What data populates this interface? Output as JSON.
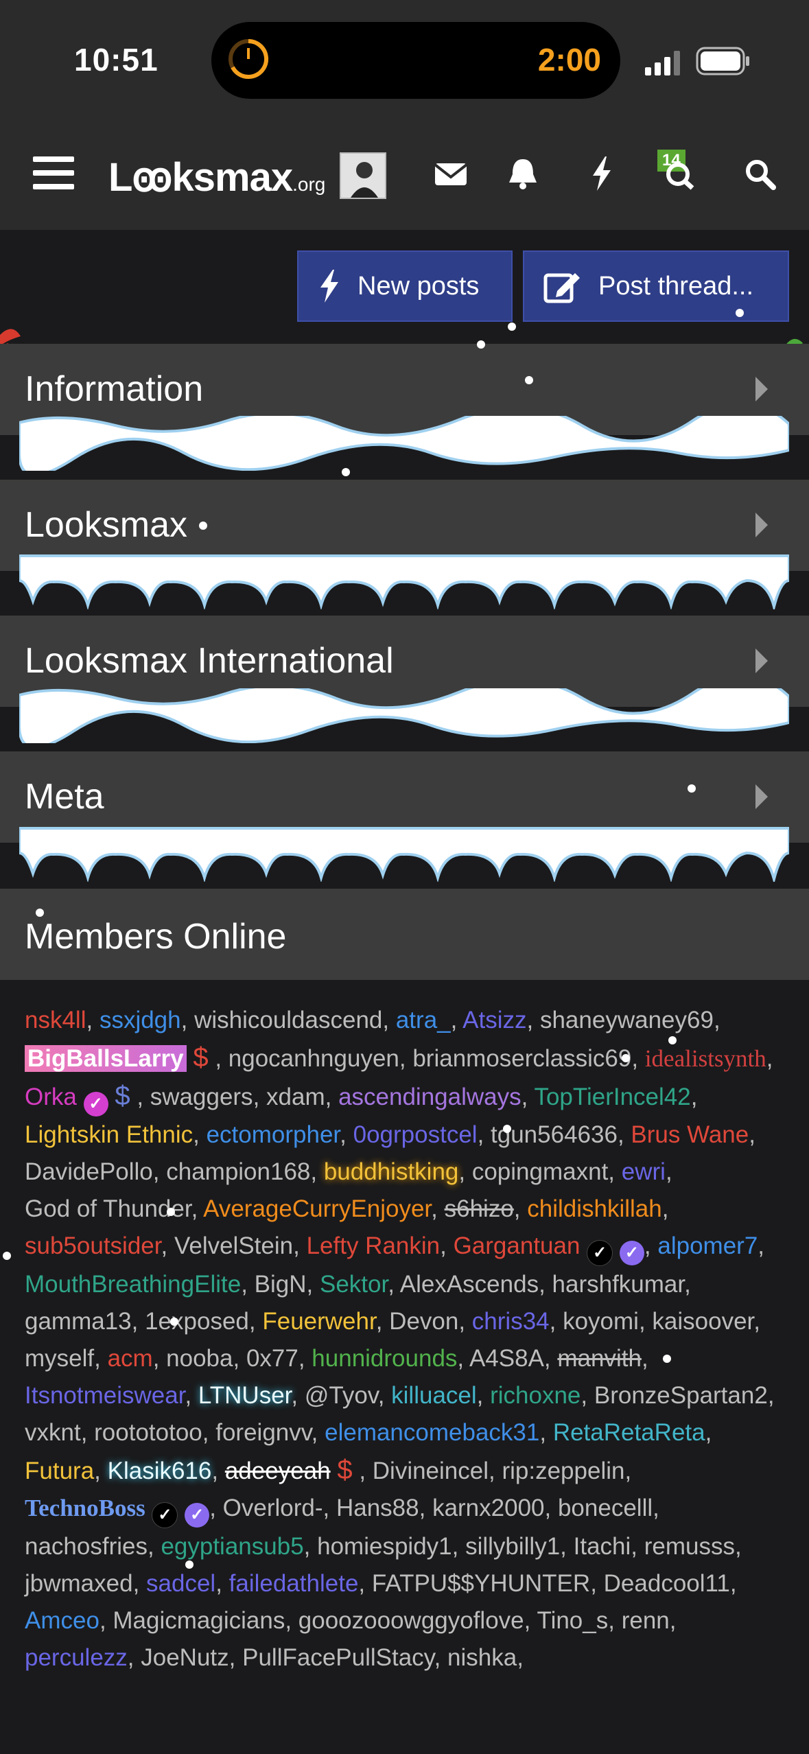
{
  "status": {
    "time": "10:51",
    "timer": "2:00"
  },
  "header": {
    "logo_main": "Lꙭksmax",
    "logo_suffix": ".org",
    "notif_count": "14"
  },
  "buttons": {
    "new_posts": "New posts",
    "post_thread": "Post thread..."
  },
  "categories": [
    "Information",
    "Looksmax",
    "Looksmax International",
    "Meta"
  ],
  "members_title": "Members Online",
  "members": [
    {
      "n": "nsk4ll",
      "c": "c-red"
    },
    {
      "n": "ssxjdgh",
      "c": "c-blue"
    },
    {
      "n": "wishicouldascend",
      "c": "c-gray"
    },
    {
      "n": "atra_",
      "c": "c-blue"
    },
    {
      "n": "Atsizz",
      "c": "c-indigo"
    },
    {
      "n": "shaneywaney69",
      "c": "c-gray"
    },
    {
      "n": "BigBallsLarry",
      "c": "glow-pink",
      "dollar": "red"
    },
    {
      "n": "ngocanhnguyen",
      "c": "c-gray"
    },
    {
      "n": "brianmoserclassic69",
      "c": "c-gray"
    },
    {
      "n": "idealistsynth",
      "c": "serif-red"
    },
    {
      "n": "Orka",
      "c": "c-magenta",
      "check": "mag",
      "dollar": "blue"
    },
    {
      "n": "swaggers",
      "c": "c-gray"
    },
    {
      "n": "xdam",
      "c": "c-gray"
    },
    {
      "n": "ascendingalways",
      "c": "c-purple"
    },
    {
      "n": "TopTierIncel42",
      "c": "c-teal"
    },
    {
      "n": "Lightskin Ethnic",
      "c": "c-yellow"
    },
    {
      "n": "ectomorpher",
      "c": "c-blue"
    },
    {
      "n": "0ogrpostcel",
      "c": "c-indigo"
    },
    {
      "n": "tgun564636",
      "c": "c-gray"
    },
    {
      "n": "Brus Wane",
      "c": "c-red"
    },
    {
      "n": "DavidePollo",
      "c": "c-gray"
    },
    {
      "n": "champion168",
      "c": "c-gray"
    },
    {
      "n": "buddhistking",
      "c": "glow-yellow"
    },
    {
      "n": "copingmaxnt",
      "c": "c-gray"
    },
    {
      "n": "ewri",
      "c": "c-indigo"
    },
    {
      "n": "God of Thunder",
      "c": "c-gray"
    },
    {
      "n": "AverageCurryEnjoyer",
      "c": "c-orange"
    },
    {
      "n": "s6hizo",
      "c": "c-gray strike"
    },
    {
      "n": "childishkillah",
      "c": "c-orange"
    },
    {
      "n": "sub5outsider",
      "c": "c-red"
    },
    {
      "n": "VelvelStein",
      "c": "c-gray"
    },
    {
      "n": "Lefty Rankin",
      "c": "c-red"
    },
    {
      "n": "Gargantuan",
      "c": "c-red",
      "check": "black",
      "check2": "violet"
    },
    {
      "n": "alpomer7",
      "c": "c-blue"
    },
    {
      "n": "MouthBreathingElite",
      "c": "c-teal"
    },
    {
      "n": "BigN",
      "c": "c-gray"
    },
    {
      "n": "Sektor",
      "c": "c-teal"
    },
    {
      "n": "AlexAscends",
      "c": "c-gray"
    },
    {
      "n": "harshfkumar",
      "c": "c-gray"
    },
    {
      "n": "gamma13",
      "c": "c-gray"
    },
    {
      "n": "1exposed",
      "c": "c-gray"
    },
    {
      "n": "Feuerwehr",
      "c": "c-yellow"
    },
    {
      "n": "Devon",
      "c": "c-gray"
    },
    {
      "n": "chris34",
      "c": "c-indigo"
    },
    {
      "n": "koyomi",
      "c": "c-gray"
    },
    {
      "n": "kaisoover",
      "c": "c-gray"
    },
    {
      "n": "myself",
      "c": "c-gray"
    },
    {
      "n": "acm",
      "c": "c-red"
    },
    {
      "n": "nooba",
      "c": "c-gray"
    },
    {
      "n": "0x77",
      "c": "c-gray"
    },
    {
      "n": "hunnidrounds",
      "c": "c-green"
    },
    {
      "n": "A4S8A",
      "c": "c-gray"
    },
    {
      "n": "manvith",
      "c": "c-gray strike"
    },
    {
      "n": "Itsnotmeiswear",
      "c": "c-indigo"
    },
    {
      "n": "LTNUser",
      "c": "glow-cyan"
    },
    {
      "n": "@Tyov",
      "c": "c-gray"
    },
    {
      "n": "killuacel",
      "c": "c-cyan"
    },
    {
      "n": "richoxne",
      "c": "c-teal"
    },
    {
      "n": "BronzeSpartan2",
      "c": "c-gray"
    },
    {
      "n": "vxknt",
      "c": "c-gray"
    },
    {
      "n": "rootototoo",
      "c": "c-gray"
    },
    {
      "n": "foreignvv",
      "c": "c-gray"
    },
    {
      "n": "elemancomeback31",
      "c": "c-blue"
    },
    {
      "n": "RetaRetaReta",
      "c": "c-cyan"
    },
    {
      "n": "Futura",
      "c": "c-yellow"
    },
    {
      "n": "Klasik616",
      "c": "glow-cyan"
    },
    {
      "n": "adeeyeah",
      "c": "c-white strike",
      "dollar": "red"
    },
    {
      "n": "Divineincel",
      "c": "c-gray"
    },
    {
      "n": "rip:zeppelin",
      "c": "c-gray"
    },
    {
      "n": "TechnoBoss",
      "c": "serif-blue",
      "check": "black",
      "check2": "violet"
    },
    {
      "n": "Overlord-",
      "c": "c-gray"
    },
    {
      "n": "Hans88",
      "c": "c-gray"
    },
    {
      "n": "karnx2000",
      "c": "c-gray"
    },
    {
      "n": "bonecelll",
      "c": "c-gray"
    },
    {
      "n": "nachosfries",
      "c": "c-gray"
    },
    {
      "n": "egyptiansub5",
      "c": "c-teal"
    },
    {
      "n": "homiespidy1",
      "c": "c-gray"
    },
    {
      "n": "sillybilly1",
      "c": "c-gray"
    },
    {
      "n": "Itachi",
      "c": "c-gray"
    },
    {
      "n": "remusss",
      "c": "c-gray"
    },
    {
      "n": "jbwmaxed",
      "c": "c-gray"
    },
    {
      "n": "sadcel",
      "c": "c-indigo"
    },
    {
      "n": "failedathlete",
      "c": "c-indigo"
    },
    {
      "n": "FATPU$$YHUNTER",
      "c": "c-gray"
    },
    {
      "n": "Deadcool11",
      "c": "c-gray"
    },
    {
      "n": "Amceo",
      "c": "c-blue"
    },
    {
      "n": "Magicmagicians",
      "c": "c-gray"
    },
    {
      "n": "gooozooowggyoflove",
      "c": "c-gray"
    },
    {
      "n": "Tino_s",
      "c": "c-gray"
    },
    {
      "n": "renn",
      "c": "c-gray"
    },
    {
      "n": "perculezz",
      "c": "c-indigo"
    },
    {
      "n": "JoeNutz",
      "c": "c-gray"
    },
    {
      "n": "PullFacePullStacy",
      "c": "c-gray"
    },
    {
      "n": "nishka",
      "c": "c-gray"
    }
  ]
}
